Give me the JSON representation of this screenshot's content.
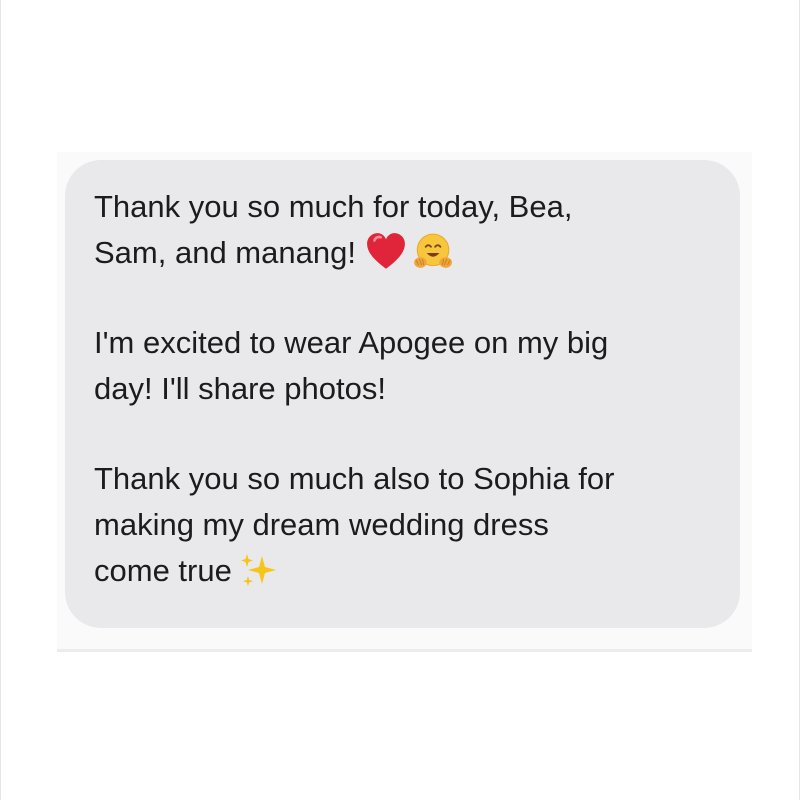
{
  "message": {
    "paragraphs": [
      {
        "lines": [
          "Thank you so much for today, Bea,",
          "Sam, and manang!"
        ]
      },
      {
        "lines": [
          "I'm excited to wear Apogee on my big",
          "day! I'll share photos!"
        ]
      },
      {
        "lines": [
          "Thank you so much also to Sophia for",
          "making my dream wedding dress",
          "come true"
        ]
      }
    ],
    "emojis": {
      "para1": [
        "red-heart-icon",
        "hugging-face-icon"
      ],
      "para3": [
        "sparkles-icon"
      ]
    }
  },
  "colors": {
    "bubble": "#e9e9eb",
    "text": "#1c1c1e",
    "heart": "#e0243a",
    "sparkle": "#f5c518"
  }
}
